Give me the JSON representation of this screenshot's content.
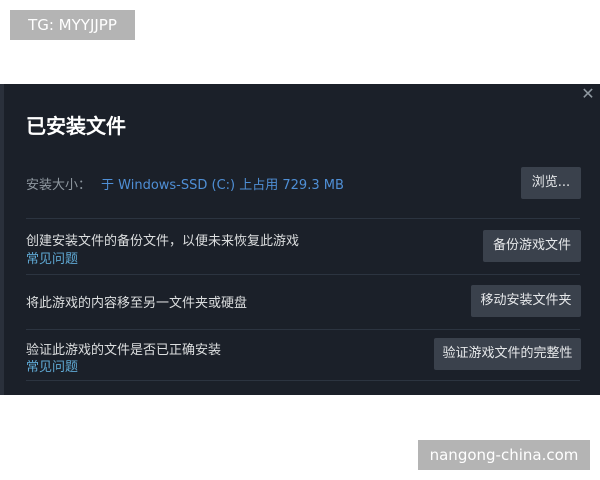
{
  "watermarks": {
    "top": "TG: MYYJJPP",
    "bottom": "nangong-china.com"
  },
  "dialog": {
    "close_icon": "close-icon",
    "title": "已安装文件",
    "install_size_label": "安装大小：",
    "install_size_value": "于 Windows-SSD (C:) 上占用 729.3 MB",
    "browse_button": "浏览...",
    "rows": [
      {
        "text": "创建安装文件的备份文件，以便未来恢复此游戏",
        "link": "常见问题",
        "button": "备份游戏文件"
      },
      {
        "text": "将此游戏的内容移至另一文件夹或硬盘",
        "button": "移动安装文件夹"
      },
      {
        "text": "验证此游戏的文件是否已正确安装",
        "link": "常见问题",
        "button": "验证游戏文件的完整性"
      }
    ]
  },
  "colors": {
    "dialog_bg": "#1b2029",
    "accent_blue": "#4f8fd6",
    "link_blue": "#5fa8d3",
    "button_bg": "#3a414c"
  }
}
